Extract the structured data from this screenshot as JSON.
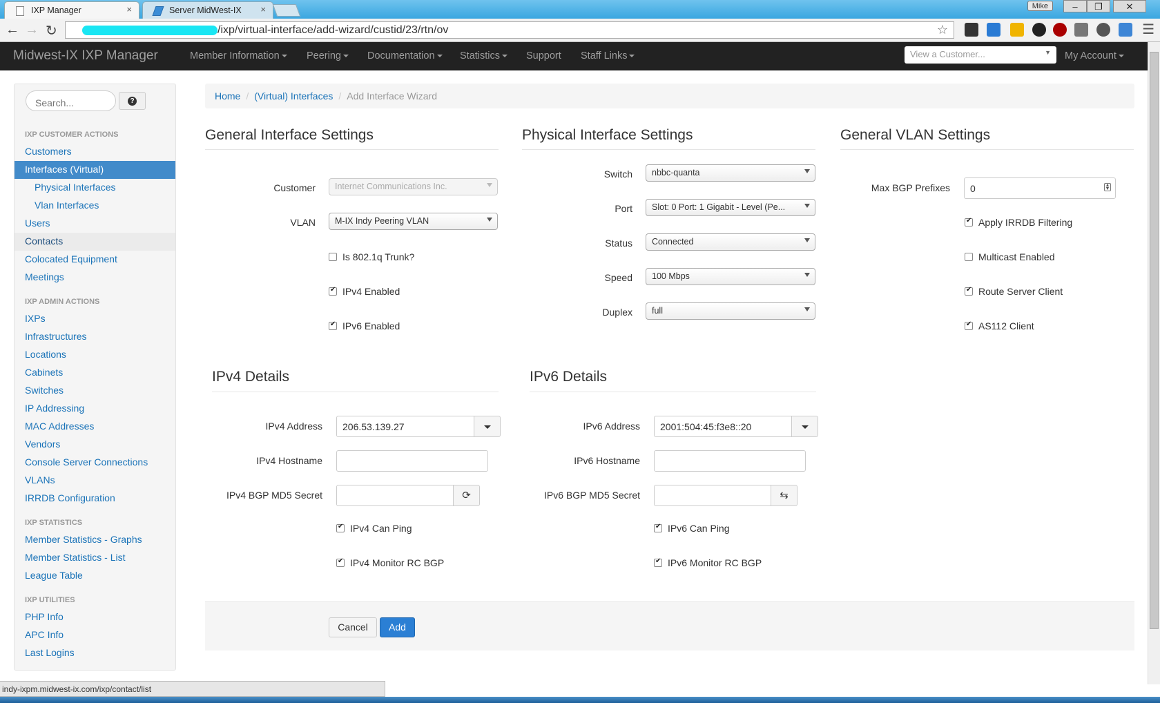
{
  "browser": {
    "tabs": [
      {
        "label": "IXP Manager",
        "close": "×"
      },
      {
        "label": "Server MidWest-IX",
        "close": "×"
      }
    ],
    "user_badge": "Mike",
    "window_controls": {
      "minimize": "–",
      "restore": "❐",
      "close": "✕"
    },
    "url": "/ixp/virtual-interface/add-wizard/custid/23/rtn/ov",
    "status_url": "indy-ixpm.midwest-ix.com/ixp/contact/list"
  },
  "navbar": {
    "brand": "Midwest-IX IXP Manager",
    "items": [
      "Member Information",
      "Peering",
      "Documentation",
      "Statistics",
      "Support",
      "Staff Links"
    ],
    "customer_select_placeholder": "View a Customer...",
    "account": "My Account"
  },
  "sidebar": {
    "search_placeholder": "Search...",
    "help": "?",
    "sections": [
      {
        "header": "IXP CUSTOMER ACTIONS",
        "items": [
          "Customers",
          "Interfaces (Virtual)",
          "Physical Interfaces",
          "Vlan Interfaces",
          "Users",
          "Contacts",
          "Colocated Equipment",
          "Meetings"
        ]
      },
      {
        "header": "IXP ADMIN ACTIONS",
        "items": [
          "IXPs",
          "Infrastructures",
          "Locations",
          "Cabinets",
          "Switches",
          "IP Addressing",
          "MAC Addresses",
          "Vendors",
          "Console Server Connections",
          "VLANs",
          "IRRDB Configuration"
        ]
      },
      {
        "header": "IXP STATISTICS",
        "items": [
          "Member Statistics - Graphs",
          "Member Statistics - List",
          "League Table"
        ]
      },
      {
        "header": "IXP UTILITIES",
        "items": [
          "PHP Info",
          "APC Info",
          "Last Logins"
        ]
      }
    ]
  },
  "breadcrumb": [
    "Home",
    "(Virtual) Interfaces",
    "Add Interface Wizard"
  ],
  "general": {
    "title": "General Interface Settings",
    "customer_label": "Customer",
    "customer_value": "Internet Communications Inc.",
    "vlan_label": "VLAN",
    "vlan_value": "M-IX Indy Peering VLAN",
    "trunk_label": "Is 802.1q Trunk?",
    "ipv4_enabled_label": "IPv4 Enabled",
    "ipv6_enabled_label": "IPv6 Enabled",
    "trunk_checked": false,
    "ipv4_enabled_checked": true,
    "ipv6_enabled_checked": true
  },
  "physical": {
    "title": "Physical Interface Settings",
    "switch_label": "Switch",
    "switch_value": "nbbc-quanta",
    "port_label": "Port",
    "port_value": "Slot: 0 Port: 1 Gigabit - Level (Pe...",
    "status_label": "Status",
    "status_value": "Connected",
    "speed_label": "Speed",
    "speed_value": "100 Mbps",
    "duplex_label": "Duplex",
    "duplex_value": "full"
  },
  "vlan": {
    "title": "General VLAN Settings",
    "max_bgp_label": "Max BGP Prefixes",
    "max_bgp_value": "0",
    "irrdb_label": "Apply IRRDB Filtering",
    "irrdb_checked": true,
    "multicast_label": "Multicast Enabled",
    "multicast_checked": false,
    "rsclient_label": "Route Server Client",
    "rsclient_checked": true,
    "as112_label": "AS112 Client",
    "as112_checked": true
  },
  "ipv4": {
    "title": "IPv4 Details",
    "address_label": "IPv4 Address",
    "address_value": "206.53.139.27",
    "hostname_label": "IPv4 Hostname",
    "hostname_value": "",
    "md5_label": "IPv4 BGP MD5 Secret",
    "md5_value": "",
    "canping_label": "IPv4 Can Ping",
    "canping_checked": true,
    "monitor_label": "IPv4 Monitor RC BGP",
    "monitor_checked": true
  },
  "ipv6": {
    "title": "IPv6 Details",
    "address_label": "IPv6 Address",
    "address_value": "2001:504:45:f3e8::20",
    "hostname_label": "IPv6 Hostname",
    "hostname_value": "",
    "md5_label": "IPv6 BGP MD5 Secret",
    "md5_value": "",
    "canping_label": "IPv6 Can Ping",
    "canping_checked": true,
    "monitor_label": "IPv6 Monitor RC BGP",
    "monitor_checked": true
  },
  "actions": {
    "cancel": "Cancel",
    "add": "Add"
  },
  "colors": {
    "navbar_bg": "#222222",
    "link": "#1a73b8",
    "active_item": "#428bca",
    "primary_button": "#2b7fd4"
  }
}
